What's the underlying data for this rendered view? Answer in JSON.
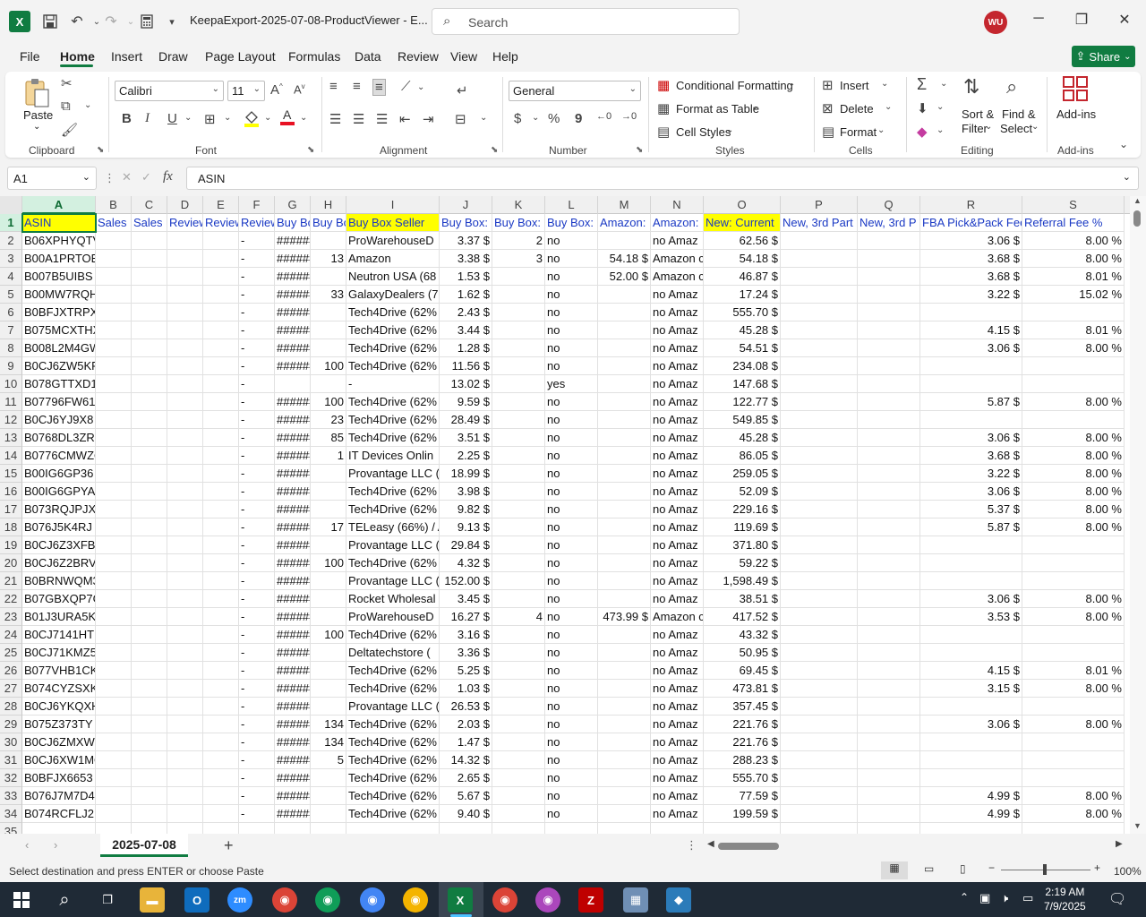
{
  "titlebar": {
    "app_logo": "X",
    "doc_title": "KeepaExport-2025-07-08-ProductViewer  -  E...",
    "search_placeholder": "Search",
    "avatar_initials": "WU"
  },
  "menu": [
    "File",
    "Home",
    "Insert",
    "Draw",
    "Page Layout",
    "Formulas",
    "Data",
    "Review",
    "View",
    "Help"
  ],
  "share_label": "Share",
  "ribbon": {
    "paste": "Paste",
    "clipboard": "Clipboard",
    "font_name": "Calibri",
    "font_size": "11",
    "font": "Font",
    "alignment": "Alignment",
    "number_format": "General",
    "number": "Number",
    "conditional_formatting": "Conditional Formatting",
    "format_as_table": "Format as Table",
    "cell_styles": "Cell Styles",
    "styles": "Styles",
    "insert": "Insert",
    "delete": "Delete",
    "format": "Format",
    "cells": "Cells",
    "sort_filter_1": "Sort &",
    "sort_filter_2": "Filter",
    "find_select_1": "Find &",
    "find_select_2": "Select",
    "editing": "Editing",
    "addins": "Add-ins",
    "addins_group": "Add-ins",
    "bold": "B",
    "italic": "I",
    "underline": "U",
    "currency": "$",
    "percent": "%",
    "comma": "9"
  },
  "formula_bar": {
    "name_box": "A1",
    "fx": "fx",
    "content": "ASIN"
  },
  "columns": [
    "A",
    "B",
    "C",
    "D",
    "E",
    "F",
    "G",
    "H",
    "I",
    "J",
    "K",
    "L",
    "M",
    "N",
    "O",
    "P",
    "Q",
    "R",
    "S"
  ],
  "header_row": [
    "ASIN",
    "Sales R",
    "Sales R",
    "Review",
    "Review",
    "Review",
    "Buy Bo",
    "Buy Bo",
    "Buy Box Seller",
    "Buy Box:",
    "Buy Box:",
    "Buy Box:",
    "Amazon:",
    "Amazon:",
    "New: Current",
    "New, 3rd Part",
    "New, 3rd P",
    "FBA Pick&Pack Fee",
    "Referral Fee %"
  ],
  "rows": [
    [
      "B06XPHYQTV",
      "",
      "",
      "",
      "",
      "-",
      "######",
      "",
      "ProWarehouseD",
      "3.37 $",
      "2",
      "no",
      "",
      "no Amaz",
      "62.56 $",
      "",
      "",
      "3.06 $",
      "8.00 %"
    ],
    [
      "B00A1PRTOE",
      "",
      "",
      "",
      "",
      "-",
      "######",
      "13",
      "Amazon",
      "3.38 $",
      "3",
      "no",
      "54.18 $",
      "Amazon c",
      "54.18 $",
      "",
      "",
      "3.68 $",
      "8.00 %"
    ],
    [
      "B007B5UIBS",
      "",
      "",
      "",
      "",
      "-",
      "######",
      "",
      "Neutron USA (68",
      "1.53 $",
      "",
      "no",
      "52.00 $",
      "Amazon c",
      "46.87 $",
      "",
      "",
      "3.68 $",
      "8.01 %"
    ],
    [
      "B00MW7RQHY",
      "",
      "",
      "",
      "",
      "-",
      "######",
      "33",
      "GalaxyDealers (7",
      "1.62 $",
      "",
      "no",
      "",
      "no Amaz",
      "17.24 $",
      "",
      "",
      "3.22 $",
      "15.02 %"
    ],
    [
      "B0BFJXTRPXV",
      "",
      "",
      "",
      "",
      "-",
      "######",
      "",
      "Tech4Drive (62%",
      "2.43 $",
      "",
      "no",
      "",
      "no Amaz",
      "555.70 $",
      "",
      "",
      "",
      ""
    ],
    [
      "B075MCXTHX",
      "",
      "",
      "",
      "",
      "-",
      "######",
      "",
      "Tech4Drive (62%",
      "3.44 $",
      "",
      "no",
      "",
      "no Amaz",
      "45.28 $",
      "",
      "",
      "4.15 $",
      "8.01 %"
    ],
    [
      "B008L2M4GW",
      "",
      "",
      "",
      "",
      "-",
      "######",
      "",
      "Tech4Drive (62%",
      "1.28 $",
      "",
      "no",
      "",
      "no Amaz",
      "54.51 $",
      "",
      "",
      "3.06 $",
      "8.00 %"
    ],
    [
      "B0CJ6ZW5KF",
      "",
      "",
      "",
      "",
      "-",
      "######",
      "100",
      "Tech4Drive (62%",
      "11.56 $",
      "",
      "no",
      "",
      "no Amaz",
      "234.08 $",
      "",
      "",
      "",
      ""
    ],
    [
      "B078GTTXD1",
      "",
      "",
      "",
      "",
      "-",
      "",
      "",
      "-",
      "13.02 $",
      "",
      "yes",
      "",
      "no Amaz",
      "147.68 $",
      "",
      "",
      "",
      ""
    ],
    [
      "B07796FW61",
      "",
      "",
      "",
      "",
      "-",
      "######",
      "100",
      "Tech4Drive (62%",
      "9.59 $",
      "",
      "no",
      "",
      "no Amaz",
      "122.77 $",
      "",
      "",
      "5.87 $",
      "8.00 %"
    ],
    [
      "B0CJ6YJ9X8",
      "",
      "",
      "",
      "",
      "-",
      "######",
      "23",
      "Tech4Drive (62%",
      "28.49 $",
      "",
      "no",
      "",
      "no Amaz",
      "549.85 $",
      "",
      "",
      "",
      ""
    ],
    [
      "B0768DL3ZR",
      "",
      "",
      "",
      "",
      "-",
      "######",
      "85",
      "Tech4Drive (62%",
      "3.51 $",
      "",
      "no",
      "",
      "no Amaz",
      "45.28 $",
      "",
      "",
      "3.06 $",
      "8.00 %"
    ],
    [
      "B0776CMWZQ",
      "",
      "",
      "",
      "",
      "-",
      "######",
      "1",
      "IT Devices Onlin",
      "2.25 $",
      "",
      "no",
      "",
      "no Amaz",
      "86.05 $",
      "",
      "",
      "3.68 $",
      "8.00 %"
    ],
    [
      "B00IG6GP36",
      "",
      "",
      "",
      "",
      "-",
      "######",
      "",
      "Provantage LLC (",
      "18.99 $",
      "",
      "no",
      "",
      "no Amaz",
      "259.05 $",
      "",
      "",
      "3.22 $",
      "8.00 %"
    ],
    [
      "B00IG6GPYA",
      "",
      "",
      "",
      "",
      "-",
      "######",
      "",
      "Tech4Drive (62%",
      "3.98 $",
      "",
      "no",
      "",
      "no Amaz",
      "52.09 $",
      "",
      "",
      "3.06 $",
      "8.00 %"
    ],
    [
      "B073RQJPJX",
      "",
      "",
      "",
      "",
      "-",
      "######",
      "",
      "Tech4Drive (62%",
      "9.82 $",
      "",
      "no",
      "",
      "no Amaz",
      "229.16 $",
      "",
      "",
      "5.37 $",
      "8.00 %"
    ],
    [
      "B076J5K4RJ",
      "",
      "",
      "",
      "",
      "-",
      "######",
      "17",
      "TELeasy (66%) / A",
      "9.13 $",
      "",
      "no",
      "",
      "no Amaz",
      "119.69 $",
      "",
      "",
      "5.87 $",
      "8.00 %"
    ],
    [
      "B0CJ6Z3XFB",
      "",
      "",
      "",
      "",
      "-",
      "######",
      "",
      "Provantage LLC (",
      "29.84 $",
      "",
      "no",
      "",
      "no Amaz",
      "371.80 $",
      "",
      "",
      "",
      ""
    ],
    [
      "B0CJ6Z2BRV",
      "",
      "",
      "",
      "",
      "-",
      "######",
      "100",
      "Tech4Drive (62%",
      "4.32 $",
      "",
      "no",
      "",
      "no Amaz",
      "59.22 $",
      "",
      "",
      "",
      ""
    ],
    [
      "B0BRNWQM3W",
      "",
      "",
      "",
      "",
      "-",
      "######",
      "",
      "Provantage LLC (",
      "152.00 $",
      "",
      "no",
      "",
      "no Amaz",
      "1,598.49 $",
      "",
      "",
      "",
      ""
    ],
    [
      "B07GBXQP7G",
      "",
      "",
      "",
      "",
      "-",
      "######",
      "",
      "Rocket Wholesal",
      "3.45 $",
      "",
      "no",
      "",
      "no Amaz",
      "38.51 $",
      "",
      "",
      "3.06 $",
      "8.00 %"
    ],
    [
      "B01J3URA5K",
      "",
      "",
      "",
      "",
      "-",
      "######",
      "",
      "ProWarehouseD",
      "16.27 $",
      "4",
      "no",
      "473.99 $",
      "Amazon c",
      "417.52 $",
      "",
      "",
      "3.53 $",
      "8.00 %"
    ],
    [
      "B0CJ7141HT",
      "",
      "",
      "",
      "",
      "-",
      "######",
      "100",
      "Tech4Drive (62%",
      "3.16 $",
      "",
      "no",
      "",
      "no Amaz",
      "43.32 $",
      "",
      "",
      "",
      ""
    ],
    [
      "B0CJ71KMZ5",
      "",
      "",
      "",
      "",
      "-",
      "######",
      "",
      "Deltatechstore (",
      "3.36 $",
      "",
      "no",
      "",
      "no Amaz",
      "50.95 $",
      "",
      "",
      "",
      ""
    ],
    [
      "B077VHB1CK",
      "",
      "",
      "",
      "",
      "-",
      "######",
      "",
      "Tech4Drive (62%",
      "5.25 $",
      "",
      "no",
      "",
      "no Amaz",
      "69.45 $",
      "",
      "",
      "4.15 $",
      "8.01 %"
    ],
    [
      "B074CYZSXK",
      "",
      "",
      "",
      "",
      "-",
      "######",
      "",
      "Tech4Drive (62%",
      "1.03 $",
      "",
      "no",
      "",
      "no Amaz",
      "473.81 $",
      "",
      "",
      "3.15 $",
      "8.00 %"
    ],
    [
      "B0CJ6YKQXH",
      "",
      "",
      "",
      "",
      "-",
      "######",
      "",
      "Provantage LLC (",
      "26.53 $",
      "",
      "no",
      "",
      "no Amaz",
      "357.45 $",
      "",
      "",
      "",
      ""
    ],
    [
      "B075Z373TY",
      "",
      "",
      "",
      "",
      "-",
      "######",
      "134",
      "Tech4Drive (62%",
      "2.03 $",
      "",
      "no",
      "",
      "no Amaz",
      "221.76 $",
      "",
      "",
      "3.06 $",
      "8.00 %"
    ],
    [
      "B0CJ6ZMXWN",
      "",
      "",
      "",
      "",
      "-",
      "######",
      "134",
      "Tech4Drive (62%",
      "1.47 $",
      "",
      "no",
      "",
      "no Amaz",
      "221.76 $",
      "",
      "",
      "",
      ""
    ],
    [
      "B0CJ6XW1MQ",
      "",
      "",
      "",
      "",
      "-",
      "######",
      "5",
      "Tech4Drive (62%",
      "14.32 $",
      "",
      "no",
      "",
      "no Amaz",
      "288.23 $",
      "",
      "",
      "",
      ""
    ],
    [
      "B0BFJX6653",
      "",
      "",
      "",
      "",
      "-",
      "######",
      "",
      "Tech4Drive (62%",
      "2.65 $",
      "",
      "no",
      "",
      "no Amaz",
      "555.70 $",
      "",
      "",
      "",
      ""
    ],
    [
      "B076J7M7D4",
      "",
      "",
      "",
      "",
      "-",
      "######",
      "",
      "Tech4Drive (62%",
      "5.67 $",
      "",
      "no",
      "",
      "no Amaz",
      "77.59 $",
      "",
      "",
      "4.99 $",
      "8.00 %"
    ],
    [
      "B074RCFLJ2",
      "",
      "",
      "",
      "",
      "-",
      "######",
      "",
      "Tech4Drive (62%",
      "9.40 $",
      "",
      "no",
      "",
      "no Amaz",
      "199.59 $",
      "",
      "",
      "4.99 $",
      "8.00 %"
    ]
  ],
  "sheet_tab": "2025-07-08",
  "status_text": "Select destination and press ENTER or choose Paste",
  "zoom": "100%",
  "clock_time": "2:19 AM",
  "clock_date": "7/9/2025",
  "colors": {
    "accent": "#107c41",
    "header_text": "#1a39c4",
    "highlight": "#ffff00"
  }
}
